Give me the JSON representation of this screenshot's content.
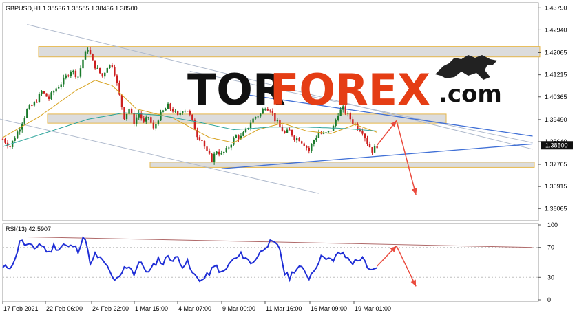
{
  "header": {
    "symbol": "GBPUSD,H1",
    "ohlc": "1.38536 1.38585 1.38436 1.38500"
  },
  "watermark": {
    "tor": "TOR",
    "forex": "FOREX",
    "dotcom": ".com",
    "brand_colors": {
      "tor": "#111111",
      "forex": "#e53d14",
      "dotcom": "#111111"
    }
  },
  "rsi_header": "RSI(13) 42.5907",
  "colors": {
    "bull": "#1a7a2b",
    "bear": "#cc1f1f",
    "ma_fast": "#d7a21f",
    "ma_slow": "#2aa39a",
    "rsi": "#1f2ed6",
    "trend_blue": "#3f6fd6",
    "channel": "#aeb9cc",
    "rsi_trend": "#b06a6a",
    "arrow": "#ea4a3d",
    "zone_fill": "#dcdcdc",
    "zone_border": "#e5b64a"
  },
  "chart_data": [
    {
      "type": "candlestick",
      "ylim": [
        1.3565,
        1.4393
      ],
      "y_ticks": [
        "1.43790",
        "1.42940",
        "1.42065",
        "1.41215",
        "1.40365",
        "1.39490",
        "1.38640",
        "1.37765",
        "1.36915",
        "1.36065"
      ],
      "current_price": "1.38500",
      "x_ticks": [
        "17 Feb 2021",
        "22 Feb 06:00",
        "24 Feb 22:00",
        "1 Mar 15:00",
        "4 Mar 07:00",
        "9 Mar 00:00",
        "11 Mar 16:00",
        "16 Mar 09:00",
        "19 Mar 01:00"
      ],
      "close_path": [
        [
          0,
          1.3875
        ],
        [
          3,
          1.3845
        ],
        [
          7,
          1.392
        ],
        [
          10,
          1.3985
        ],
        [
          13,
          1.401
        ],
        [
          16,
          1.4055
        ],
        [
          19,
          1.403
        ],
        [
          22,
          1.407
        ],
        [
          25,
          1.41
        ],
        [
          28,
          1.414
        ],
        [
          31,
          1.4115
        ],
        [
          33,
          1.418
        ],
        [
          35,
          1.4225
        ],
        [
          37,
          1.417
        ],
        [
          39,
          1.414
        ],
        [
          41,
          1.4115
        ],
        [
          43,
          1.4155
        ],
        [
          45,
          1.416
        ],
        [
          46,
          1.413
        ],
        [
          48,
          1.404
        ],
        [
          50,
          1.396
        ],
        [
          52,
          1.399
        ],
        [
          54,
          1.394
        ],
        [
          56,
          1.3975
        ],
        [
          58,
          1.3935
        ],
        [
          60,
          1.396
        ],
        [
          62,
          1.391
        ],
        [
          64,
          1.3955
        ],
        [
          66,
          1.398
        ],
        [
          68,
          1.4
        ],
        [
          70,
          1.3985
        ],
        [
          72,
          1.396
        ],
        [
          74,
          1.399
        ],
        [
          76,
          1.3985
        ],
        [
          78,
          1.394
        ],
        [
          80,
          1.389
        ],
        [
          82,
          1.387
        ],
        [
          84,
          1.382
        ],
        [
          86,
          1.3795
        ],
        [
          88,
          1.383
        ],
        [
          90,
          1.3815
        ],
        [
          92,
          1.383
        ],
        [
          94,
          1.386
        ],
        [
          96,
          1.3885
        ],
        [
          98,
          1.388
        ],
        [
          100,
          1.3905
        ],
        [
          102,
          1.394
        ],
        [
          104,
          1.396
        ],
        [
          106,
          1.397
        ],
        [
          108,
          1.4
        ],
        [
          110,
          1.399
        ],
        [
          112,
          1.395
        ],
        [
          114,
          1.392
        ],
        [
          116,
          1.3895
        ],
        [
          118,
          1.3905
        ],
        [
          120,
          1.388
        ],
        [
          122,
          1.3875
        ],
        [
          124,
          1.3855
        ],
        [
          126,
          1.383
        ],
        [
          128,
          1.387
        ],
        [
          130,
          1.39
        ],
        [
          132,
          1.389
        ],
        [
          134,
          1.39
        ],
        [
          136,
          1.392
        ],
        [
          138,
          1.3975
        ],
        [
          140,
          1.399
        ],
        [
          142,
          1.3965
        ],
        [
          144,
          1.394
        ],
        [
          146,
          1.392
        ],
        [
          148,
          1.3905
        ],
        [
          150,
          1.386
        ],
        [
          152,
          1.383
        ],
        [
          154,
          1.385
        ]
      ],
      "ma_fast": [
        [
          0,
          1.388
        ],
        [
          15,
          1.396
        ],
        [
          30,
          1.406
        ],
        [
          38,
          1.41
        ],
        [
          45,
          1.408
        ],
        [
          55,
          1.399
        ],
        [
          70,
          1.3955
        ],
        [
          85,
          1.388
        ],
        [
          95,
          1.386
        ],
        [
          105,
          1.391
        ],
        [
          115,
          1.3935
        ],
        [
          125,
          1.3905
        ],
        [
          135,
          1.3895
        ],
        [
          145,
          1.393
        ],
        [
          154,
          1.39
        ]
      ],
      "ma_slow": [
        [
          0,
          1.3845
        ],
        [
          20,
          1.3905
        ],
        [
          35,
          1.395
        ],
        [
          50,
          1.3975
        ],
        [
          65,
          1.3965
        ],
        [
          80,
          1.394
        ],
        [
          95,
          1.391
        ],
        [
          110,
          1.392
        ],
        [
          125,
          1.392
        ],
        [
          140,
          1.3915
        ],
        [
          154,
          1.3905
        ]
      ],
      "zones": [
        [
          1.419,
          1.423
        ],
        [
          1.3935,
          1.397
        ],
        [
          1.3765,
          1.3785
        ]
      ],
      "trendlines": [
        {
          "kind": "channel",
          "from": [
            10,
            1.4315
          ],
          "to": [
            218,
            1.3835
          ]
        },
        {
          "kind": "channel",
          "from": [
            -3,
            1.3955
          ],
          "to": [
            130,
            1.3665
          ]
        },
        {
          "kind": "channel",
          "from": [
            77,
            1.4135
          ],
          "to": [
            218,
            1.386
          ]
        },
        {
          "kind": "blue",
          "from": [
            100,
            1.4045
          ],
          "to": [
            218,
            1.3885
          ]
        },
        {
          "kind": "blue",
          "from": [
            90,
            1.376
          ],
          "to": [
            218,
            1.3855
          ]
        }
      ],
      "forecast": [
        [
          154,
          1.385
        ],
        [
          162,
          1.3945
        ],
        [
          170,
          1.366
        ]
      ]
    },
    {
      "type": "line",
      "name": "RSI(13)",
      "value": "42.5907",
      "ylim": [
        0,
        100
      ],
      "y_ticks": [
        "100",
        "70",
        "30",
        "0"
      ],
      "levels": [
        30,
        70
      ],
      "values": [
        [
          0,
          42
        ],
        [
          3,
          45
        ],
        [
          5,
          52
        ],
        [
          7,
          80
        ],
        [
          9,
          74
        ],
        [
          11,
          72
        ],
        [
          13,
          68
        ],
        [
          15,
          75
        ],
        [
          17,
          70
        ],
        [
          19,
          62
        ],
        [
          21,
          72
        ],
        [
          23,
          68
        ],
        [
          25,
          74
        ],
        [
          27,
          70
        ],
        [
          29,
          72
        ],
        [
          31,
          66
        ],
        [
          33,
          84
        ],
        [
          35,
          70
        ],
        [
          36,
          45
        ],
        [
          38,
          60
        ],
        [
          40,
          55
        ],
        [
          42,
          48
        ],
        [
          44,
          40
        ],
        [
          45,
          28
        ],
        [
          46,
          24
        ],
        [
          48,
          30
        ],
        [
          50,
          42
        ],
        [
          52,
          46
        ],
        [
          54,
          35
        ],
        [
          56,
          50
        ],
        [
          58,
          44
        ],
        [
          60,
          36
        ],
        [
          62,
          45
        ],
        [
          64,
          55
        ],
        [
          66,
          48
        ],
        [
          68,
          60
        ],
        [
          70,
          52
        ],
        [
          72,
          57
        ],
        [
          74,
          46
        ],
        [
          76,
          50
        ],
        [
          78,
          35
        ],
        [
          80,
          30
        ],
        [
          82,
          26
        ],
        [
          84,
          32
        ],
        [
          86,
          40
        ],
        [
          88,
          45
        ],
        [
          90,
          35
        ],
        [
          92,
          41
        ],
        [
          94,
          52
        ],
        [
          96,
          55
        ],
        [
          98,
          60
        ],
        [
          100,
          57
        ],
        [
          102,
          48
        ],
        [
          104,
          55
        ],
        [
          106,
          63
        ],
        [
          108,
          72
        ],
        [
          110,
          76
        ],
        [
          112,
          74
        ],
        [
          114,
          68
        ],
        [
          116,
          35
        ],
        [
          118,
          30
        ],
        [
          120,
          40
        ],
        [
          122,
          44
        ],
        [
          124,
          38
        ],
        [
          126,
          30
        ],
        [
          128,
          40
        ],
        [
          130,
          52
        ],
        [
          132,
          60
        ],
        [
          134,
          55
        ],
        [
          136,
          50
        ],
        [
          138,
          64
        ],
        [
          140,
          60
        ],
        [
          142,
          55
        ],
        [
          144,
          50
        ],
        [
          146,
          52
        ],
        [
          148,
          58
        ],
        [
          150,
          40
        ],
        [
          152,
          38
        ],
        [
          154,
          45
        ]
      ],
      "trendline": {
        "from": [
          10,
          84
        ],
        "to": [
          218,
          70
        ]
      },
      "forecast": [
        [
          154,
          45
        ],
        [
          162,
          72
        ],
        [
          170,
          18
        ]
      ]
    }
  ]
}
